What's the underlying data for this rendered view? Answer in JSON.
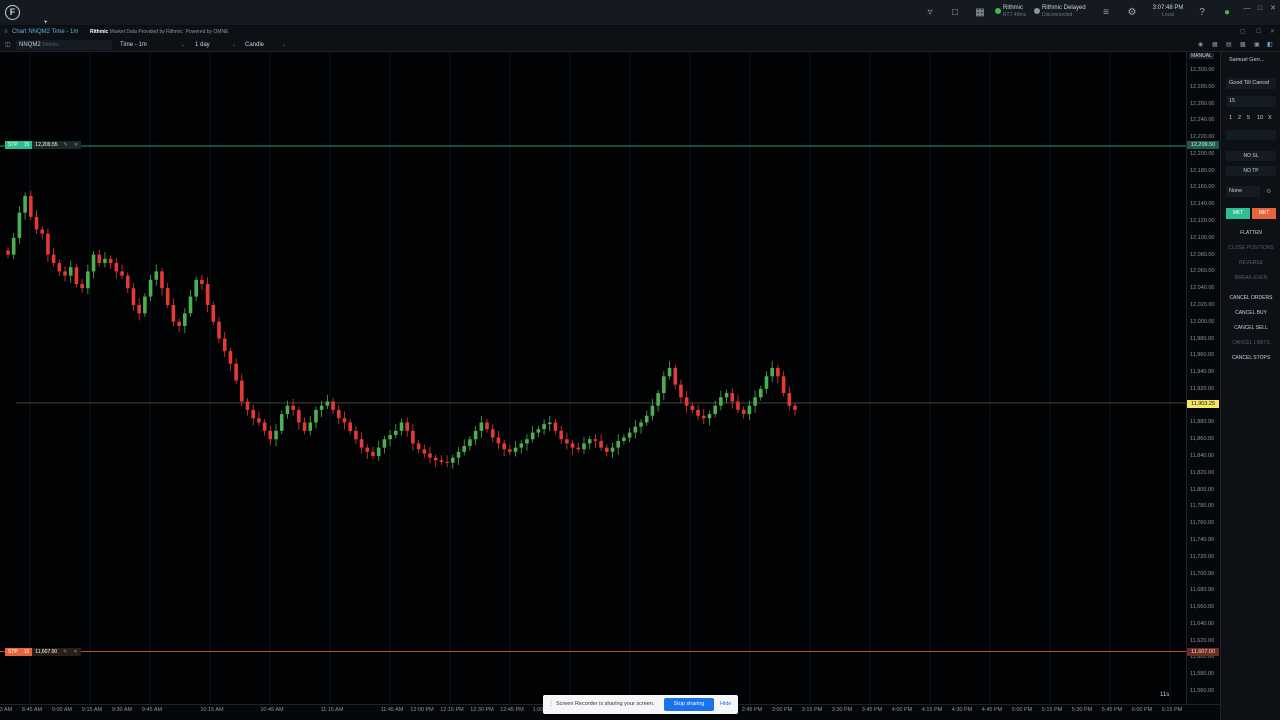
{
  "app": {
    "logo_letter": "F",
    "connections": [
      {
        "name": "Rithmic",
        "sub": "RTT 48ms",
        "color": "#3fb950"
      },
      {
        "name": "Rithmic Delayed",
        "sub": "Disconnected",
        "color": "#8b949e"
      }
    ],
    "clock": {
      "time": "3:07:48 PM",
      "zone": "Local"
    },
    "icons": [
      "bell-icon",
      "lock-icon",
      "layout-icon",
      "broadcast-icon",
      "settings-icon",
      "help-icon",
      "status-icon"
    ]
  },
  "tab": {
    "title": "Chart NNQM2 Time - 1m",
    "provider": "Rithmic",
    "provider_note": "Market Data Provided by Rithmic",
    "powered": "Powered by OMNE"
  },
  "toolbar": {
    "symbol": "NNQM2",
    "symbol_sub": "Rithmic",
    "interval": "Time - 1m",
    "range": "1 day",
    "style": "Candle"
  },
  "axis": {
    "mode_label": "MANUAL",
    "y_ticks": [
      "12,300.00",
      "12,280.00",
      "12,260.00",
      "12,240.00",
      "12,220.00",
      "12,200.00",
      "12,180.00",
      "12,160.00",
      "12,140.00",
      "12,120.00",
      "12,100.00",
      "12,080.00",
      "12,060.00",
      "12,040.00",
      "12,020.00",
      "12,000.00",
      "11,980.00",
      "11,960.00",
      "11,940.00",
      "11,920.00",
      "11,900.00",
      "11,880.00",
      "11,860.00",
      "11,840.00",
      "11,820.00",
      "11,800.00",
      "11,780.00",
      "11,760.00",
      "11,740.00",
      "11,720.00",
      "11,700.00",
      "11,680.00",
      "11,660.00",
      "11,640.00",
      "11,620.00",
      "11,600.00",
      "11,580.00",
      "11,560.00"
    ],
    "x_ticks": [
      "3 AM",
      "8:45 AM",
      "9:00 AM",
      "9:15 AM",
      "9:30 AM",
      "9:45 AM",
      "10:15 AM",
      "10:45 AM",
      "11:15 AM",
      "11:45 AM",
      "12:00 PM",
      "12:15 PM",
      "12:30 PM",
      "12:45 PM",
      "1:00",
      "2:45 PM",
      "3:00 PM",
      "3:15 PM",
      "3:30 PM",
      "3:45 PM",
      "4:00 PM",
      "4:15 PM",
      "4:30 PM",
      "4:45 PM",
      "5:00 PM",
      "5:15 PM",
      "5:30 PM",
      "5:45 PM",
      "6:00 PM",
      "6:15 PM"
    ]
  },
  "orders": {
    "upper": {
      "type": "STP",
      "qty": "15",
      "price": "12,209.55",
      "axis_price": "12,209.50",
      "color": "#2ebf91"
    },
    "lower": {
      "type": "STP",
      "qty": "15",
      "price": "11,607.00",
      "axis_price": "11,607.00",
      "color": "#e8643a"
    },
    "last_price": "11,903.25"
  },
  "side_panel": {
    "account": "Samuel Gerr...",
    "tif": "Good Till Cancel",
    "quantity": "15",
    "qty_presets": [
      "1",
      "2",
      "5",
      "10",
      "X"
    ],
    "no_sl": "NO SL",
    "no_tp": "NO TP",
    "bracket": "None",
    "buy_market": "MKT",
    "sell_market": "MKT",
    "buy_color": "#2ebf91",
    "sell_color": "#e8643a",
    "actions": [
      {
        "label": "FLATTEN",
        "enabled": true
      },
      {
        "label": "CLOSE POSITIONS",
        "enabled": false
      },
      {
        "label": "REVERSE",
        "enabled": false
      },
      {
        "label": "BREAK-EVEN",
        "enabled": false
      },
      {
        "label": "CANCEL ORDERS",
        "enabled": true
      },
      {
        "label": "CANCEL BUY",
        "enabled": true
      },
      {
        "label": "CANCEL SELL",
        "enabled": true
      },
      {
        "label": "CANCEL LIMITS",
        "enabled": false
      },
      {
        "label": "CANCEL STOPS",
        "enabled": true
      }
    ]
  },
  "screen_share": {
    "message": "Screen Recorder is sharing your screen.",
    "stop": "Stop sharing",
    "hide": "Hide"
  },
  "timer": "11s",
  "chart_data": {
    "type": "candlestick",
    "symbol": "NNQM2",
    "ylim": [
      11550,
      12310
    ],
    "colors": {
      "up": "#4caf50",
      "down": "#e53935"
    },
    "closes": [
      12080,
      12100,
      12130,
      12150,
      12125,
      12110,
      12105,
      12080,
      12070,
      12060,
      12055,
      12065,
      12045,
      12040,
      12060,
      12080,
      12070,
      12075,
      12070,
      12060,
      12055,
      12040,
      12020,
      12010,
      12030,
      12050,
      12060,
      12040,
      12020,
      12000,
      11995,
      12010,
      12030,
      12050,
      12045,
      12020,
      12000,
      11980,
      11965,
      11950,
      11930,
      11905,
      11895,
      11885,
      11880,
      11870,
      11860,
      11870,
      11890,
      11900,
      11895,
      11880,
      11870,
      11880,
      11895,
      11900,
      11905,
      11895,
      11885,
      11880,
      11870,
      11860,
      11850,
      11845,
      11840,
      11850,
      11860,
      11865,
      11870,
      11880,
      11870,
      11855,
      11848,
      11843,
      11838,
      11835,
      11833,
      11832,
      11838,
      11845,
      11852,
      11860,
      11870,
      11880,
      11872,
      11862,
      11855,
      11848,
      11845,
      11850,
      11855,
      11860,
      11868,
      11872,
      11878,
      11880,
      11870,
      11860,
      11855,
      11850,
      11848,
      11855,
      11860,
      11858,
      11850,
      11845,
      11850,
      11858,
      11862,
      11868,
      11875,
      11880,
      11888,
      11900,
      11915,
      11935,
      11945,
      11925,
      11910,
      11900,
      11895,
      11888,
      11885,
      11890,
      11900,
      11910,
      11915,
      11905,
      11895,
      11890,
      11900,
      11910,
      11920,
      11935,
      11945,
      11935,
      11915,
      11900,
      11895
    ]
  }
}
